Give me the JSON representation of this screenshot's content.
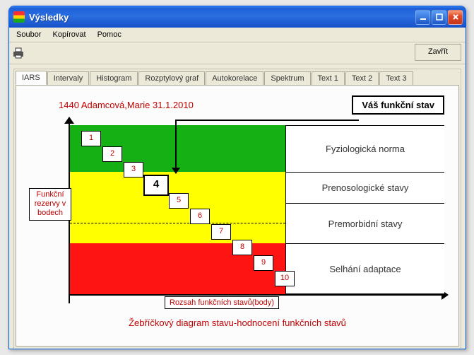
{
  "window": {
    "title": "Výsledky"
  },
  "menu": {
    "file": "Soubor",
    "copy": "Kopírovat",
    "help": "Pomoc"
  },
  "toolbar": {
    "close": "Zavřít"
  },
  "tabs": [
    "IARS",
    "Intervaly",
    "Histogram",
    "Rozptylový graf",
    "Autokorelace",
    "Spektrum",
    "Text 1",
    "Text 2",
    "Text 3"
  ],
  "patient": "1440 Adamcová,Marie 31.1.2010",
  "status_label": "Váš funkční stav",
  "y_label": "Funkční rezervy v bodech",
  "x_label": "Rozsah funkčních stavů(body)",
  "caption": "Žebříčkový diagram stavu-hodnocení funkčních stavů",
  "bands": [
    {
      "label": "Fyziologická norma",
      "color": "#14b014"
    },
    {
      "label": "Prenosologické stavy",
      "color": "#ffff00"
    },
    {
      "label": "Premorbidní stavy",
      "color": "#ffff00"
    },
    {
      "label": "Selhání adaptace",
      "color": "#ff1414"
    }
  ],
  "steps": [
    "1",
    "2",
    "3",
    "4",
    "5",
    "6",
    "7",
    "8",
    "9",
    "10"
  ],
  "current_step": 4,
  "chart_data": {
    "type": "table",
    "title": "Žebříčkový diagram stavu-hodnocení funkčních stavů",
    "xlabel": "Rozsah funkčních stavů(body)",
    "ylabel": "Funkční rezervy v bodech",
    "categories": [
      {
        "range": [
          1,
          3
        ],
        "zone": "Fyziologická norma",
        "color": "green"
      },
      {
        "range": [
          4,
          5
        ],
        "zone": "Prenosologické stavy",
        "color": "yellow"
      },
      {
        "range": [
          6,
          7
        ],
        "zone": "Premorbidní stavy",
        "color": "yellow"
      },
      {
        "range": [
          8,
          10
        ],
        "zone": "Selhání adaptace",
        "color": "red"
      }
    ],
    "value": 4,
    "value_label": "Váš funkční stav"
  }
}
